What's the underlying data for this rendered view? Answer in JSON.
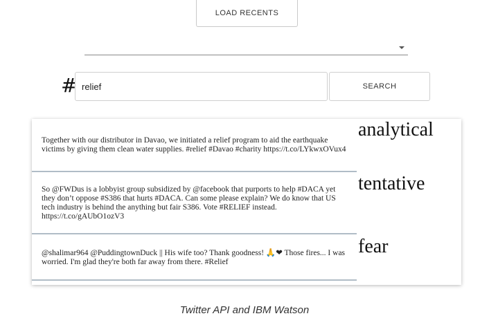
{
  "toolbar": {
    "load_recents_label": "LOAD RECENTS"
  },
  "search": {
    "hash_symbol": "#",
    "query_value": "relief",
    "button_label": "SEARCH"
  },
  "results": {
    "tweets": [
      "Together with our distributor in Davao, we initiated a relief program to aid the earthquake victims by giving them clean water supplies. #relief #Davao #charity https://t.co/LYkwxOVux4",
      "So @FWDus is a lobbyist group subsidized by @facebook that purports to help #DACA yet they don’t oppose #S386 that hurts #DACA. Can some please explain? We do know that US tech industry is behind the anything but fair S386. Vote #RELIEF instead. https://t.co/gAUbO1ozV3",
      "@shalimar964 @PuddingtownDuck || His wife too? Thank goodness! 🙏❤ Those fires... I was worried. I'm glad they're both far away from there. #Relief"
    ],
    "tones": [
      "analytical",
      "tentative",
      "fear"
    ]
  },
  "caption": "Twitter API and IBM Watson"
}
